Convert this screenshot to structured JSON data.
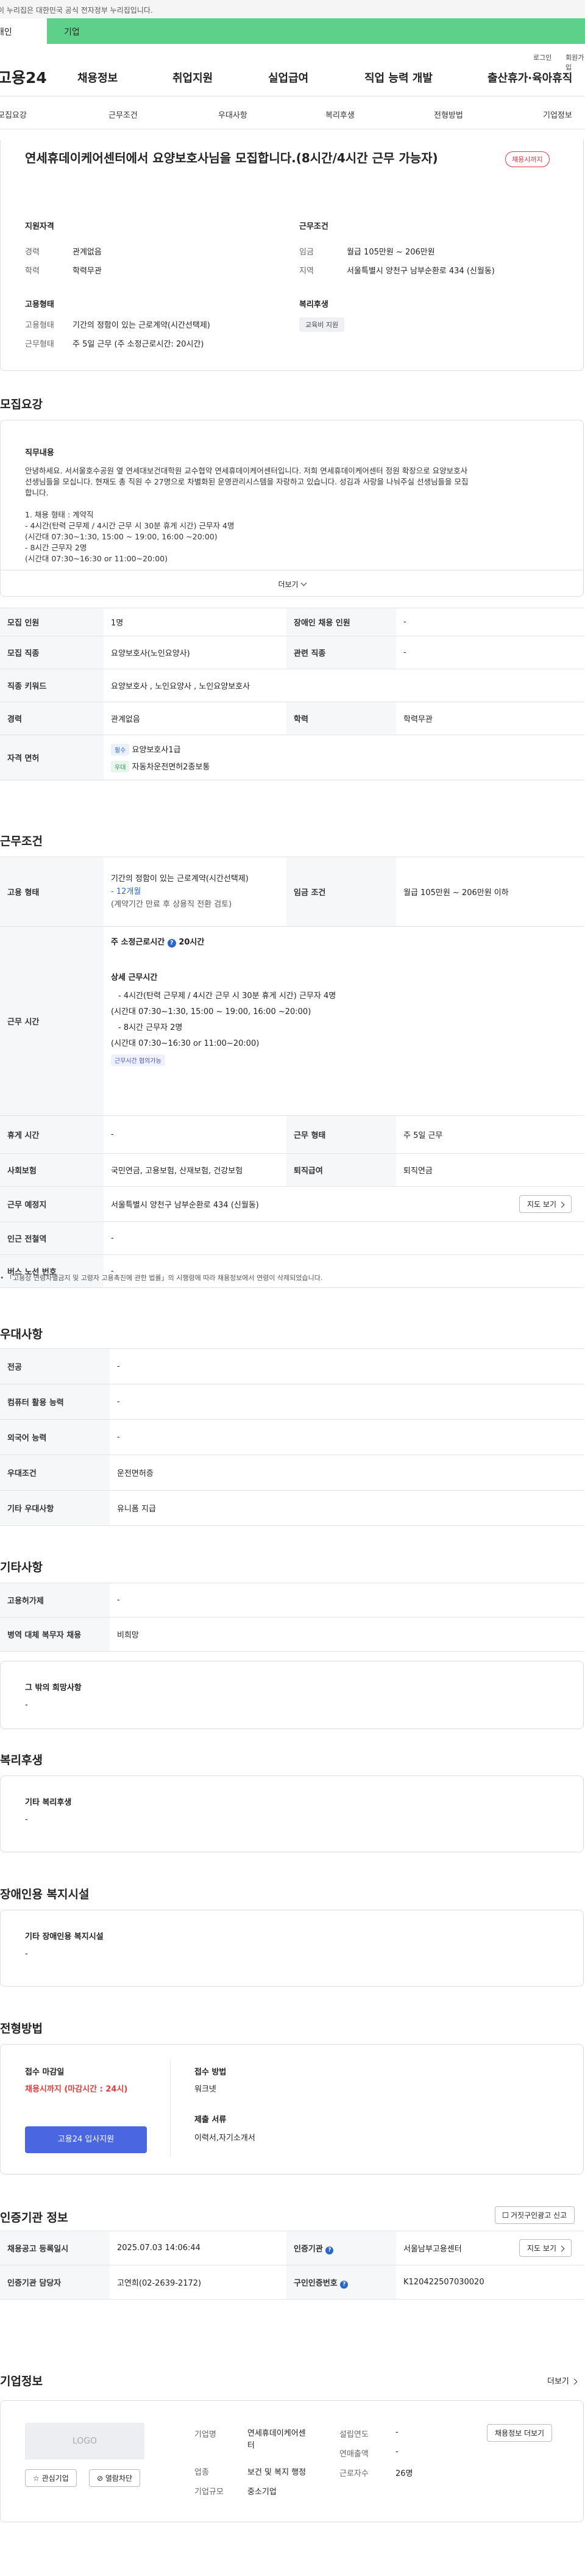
{
  "gov_banner": "이 누리집은 대한민국 공식 전자정부 누리집입니다.",
  "user_tabs": {
    "individual": "개인",
    "company": "기업"
  },
  "util": {
    "login": "로그인",
    "signup": "회원가입"
  },
  "gnb": {
    "logo": "고용24",
    "menus": [
      "채용정보",
      "취업지원",
      "실업급여",
      "직업 능력 개발",
      "출산휴가·육아휴직"
    ]
  },
  "snb": {
    "items": [
      "모집요강",
      "근무조건",
      "우대사항",
      "복리후생",
      "전형방법",
      "기업정보"
    ]
  },
  "summary": {
    "title": "연세휴데이케어센터에서 요양보호사님을 모집합니다.(8시간/4시간 근무 가능자)",
    "status_badge": "채용시까지",
    "qual_title": "지원자격",
    "career_label": "경력",
    "career_value": "관계없음",
    "edu_label": "학력",
    "edu_value": "학력무관",
    "cond_title": "근무조건",
    "wage_label": "임금",
    "wage_value": "월급 105만원 ~ 206만원",
    "loc_label": "지역",
    "loc_value": "서울특별시 양천구 남부순환로 434 (신월동)",
    "emp_title": "고용형태",
    "emp_type_label": "고용형태",
    "emp_type_value": "기간의 정함이 있는 근로계약(시간선택제)",
    "work_label": "근무형태",
    "work_value": "주 5일 근무 (주 소정근로시간: 20시간)",
    "welfare_title": "복리후생",
    "welfare_tag": "교육비 지원"
  },
  "recruit": {
    "heading": "모집요강",
    "duty_title": "직무내용",
    "duty_lines": [
      "안녕하세요. 서서울호수공원 옆 연세대보건대학원 교수협약 연세휴데이케어센터입니다. 저희 연세휴데이케어센터 정원 확장으로 요양보호사",
      "선생님들을 모십니다. 현재도 총 직원 수 27명으로 차별화된 운영관리시스템을 자랑하고 있습니다. 성김과 사랑을 나눠주실 선생님들을 모집",
      "합니다.",
      "",
      "1. 채용 형태 : 계약직",
      "  -   4시간(탄력 근무제 / 4시간 근무 시 30분 휴게 시간) 근무자 4명",
      "  (시간대 07:30~1:30, 15:00 ~ 19:00, 16:00 ~20:00)",
      "  -   8시간 근무자 2명",
      "  (시간대 07:30~16:30 or 11:00~20:00)"
    ],
    "more_label": "더보기",
    "rows": [
      {
        "k1": "모집 인원",
        "v1": "1명",
        "k2": "장애인 채용 인원",
        "v2": "-"
      },
      {
        "k1": "모집 직종",
        "v1": "요양보호사(노인요양사)",
        "k2": "관련 직종",
        "v2": "-"
      },
      {
        "k1": "직종 키워드",
        "v1": "요양보호사 , 노인요양사 , 노인요양보호사",
        "k2": "",
        "v2": ""
      },
      {
        "k1": "경력",
        "v1": "관계없음",
        "k2": "학력",
        "v2": "학력무관"
      }
    ],
    "license_label": "자격 면허",
    "licenses": [
      {
        "tag": "필수",
        "name": "요양보호사1급"
      },
      {
        "tag": "우대",
        "name": "자동차운전면허2종보통"
      }
    ]
  },
  "conditions": {
    "heading": "근무조건",
    "emp_label": "고용 형태",
    "emp_lines": [
      "기간의 정함이 있는 근로계약(시간선택제)",
      "- 12개월",
      "(계약기간 만료 후 상용직 전환 검토)"
    ],
    "wage_label": "임금 조건",
    "wage_value": "월급 105만원 ~ 206만원 이하",
    "time_label": "근무 시간",
    "weekly_hours_label": "주 소정근로시간",
    "weekly_hours_value": "20시간",
    "detail_title": "상세 근무시간",
    "detail_lines": [
      "-   4시간(탄력 근무제 / 4시간 근무 시 30분 휴게 시간) 근무자 4명",
      "(시간대 07:30~1:30, 15:00 ~ 19:00, 16:00 ~20:00)",
      "-   8시간 근무자 2명",
      "(시간대 07:30~16:30 or 11:00~20:00)"
    ],
    "time_tag": "근무시간 협의가능",
    "rest_label": "휴게 시간",
    "rest_value": "-",
    "form_label": "근무 형태",
    "form_value": "주 5일 근무",
    "insurance_label": "사회보험",
    "insurance_value": "국민연금, 고용보험, 산재보험, 건강보험",
    "retire_label": "퇴직급여",
    "retire_value": "퇴직연금",
    "place_label": "근무 예정지",
    "place_value": "서울특별시 양천구 남부순환로 434 (신월동)",
    "map_button": "지도 보기",
    "subway_label": "인근 전철역",
    "subway_value": "-",
    "bus_label": "버스 노선 번호",
    "bus_value": "-",
    "notice": "「고용상 연령차별금지 및 고령자 고용촉진에 관한 법률」의 시행령에 따라 채용정보에서 연령이 삭제되었습니다."
  },
  "preference": {
    "heading": "우대사항",
    "rows": [
      {
        "k": "전공",
        "v": "-"
      },
      {
        "k": "컴퓨터 활용 능력",
        "v": "-"
      },
      {
        "k": "외국어 능력",
        "v": "-"
      },
      {
        "k": "우대조건",
        "v": "운전면허증"
      },
      {
        "k": "기타 우대사항",
        "v": "유니폼 지급"
      }
    ]
  },
  "etc": {
    "heading": "기타사항",
    "rows": [
      {
        "k": "고용허가제",
        "v": "-"
      },
      {
        "k": "병역 대체 복무자 채용",
        "v": "비희망"
      }
    ],
    "hope_title": "그 밖의 희망사항",
    "hope_value": "-"
  },
  "welfare": {
    "heading": "복리후생",
    "title": "기타 복리후생",
    "value": "-"
  },
  "disability": {
    "heading": "장애인용 복지시설",
    "title": "기타 장애인용 복지시설",
    "value": "-"
  },
  "selection": {
    "heading": "전형방법",
    "deadline_title": "접수 마감일",
    "deadline_value": "채용시까지 (마감시간 : 24시)",
    "apply_button": "고용24 입사지원",
    "method_title": "접수 방법",
    "method_value": "워크넷",
    "docs_title": "제출 서류",
    "docs_value": "이력서,자기소개서"
  },
  "agency": {
    "heading": "인증기관 정보",
    "report_button": "거짓구인광고 신고",
    "reg_label": "채용공고 등록일시",
    "reg_value": "2025.07.03 14:06:44",
    "org_label": "인증기관",
    "org_value": "서울남부고용센터",
    "map_button": "지도 보기",
    "manager_label": "인증기관 담당자",
    "manager_value": "고연희(02-2639-2172)",
    "id_label": "구인인증번호",
    "id_value": "K120422507030020"
  },
  "company": {
    "heading": "기업정보",
    "more_label": "더보기",
    "logo_text": "LOGO",
    "fav_button": "관심기업",
    "block_button": "열람차단",
    "name_label": "기업명",
    "name_value_1": "연세휴데이케어센",
    "name_value_2": "터",
    "industry_label": "업종",
    "industry_value_1": "보건 및 복지 행정",
    "industry_value_2": "",
    "size_label": "기업규모",
    "size_value": "중소기업",
    "est_label": "설립연도",
    "est_value": "-",
    "sales_label": "연매출액",
    "sales_value": "-",
    "emp_label": "근로자수",
    "emp_value": "26명",
    "jobs_button": "채용정보 더보기"
  }
}
